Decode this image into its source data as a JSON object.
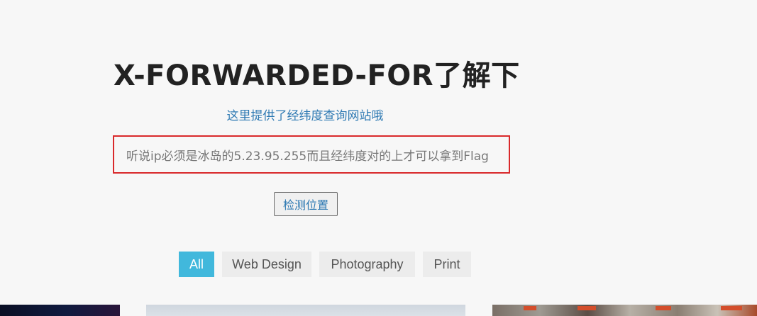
{
  "header": {
    "title": "X-FORWARDED-FOR了解下",
    "link_text": "这里提供了经纬度查询网站哦"
  },
  "hint": {
    "text": "听说ip必须是冰岛的5.23.95.255而且经纬度对的上才可以拿到Flag",
    "border_color": "#d9292b"
  },
  "detect_button": {
    "label": "检测位置"
  },
  "filters": {
    "tabs": [
      {
        "label": "All",
        "active": true
      },
      {
        "label": "Web Design",
        "active": false
      },
      {
        "label": "Photography",
        "active": false
      },
      {
        "label": "Print",
        "active": false
      }
    ],
    "active_color": "#41b8dc"
  },
  "colors": {
    "background": "#f7f7f7",
    "link": "#2f7ab3",
    "title": "#222222"
  }
}
